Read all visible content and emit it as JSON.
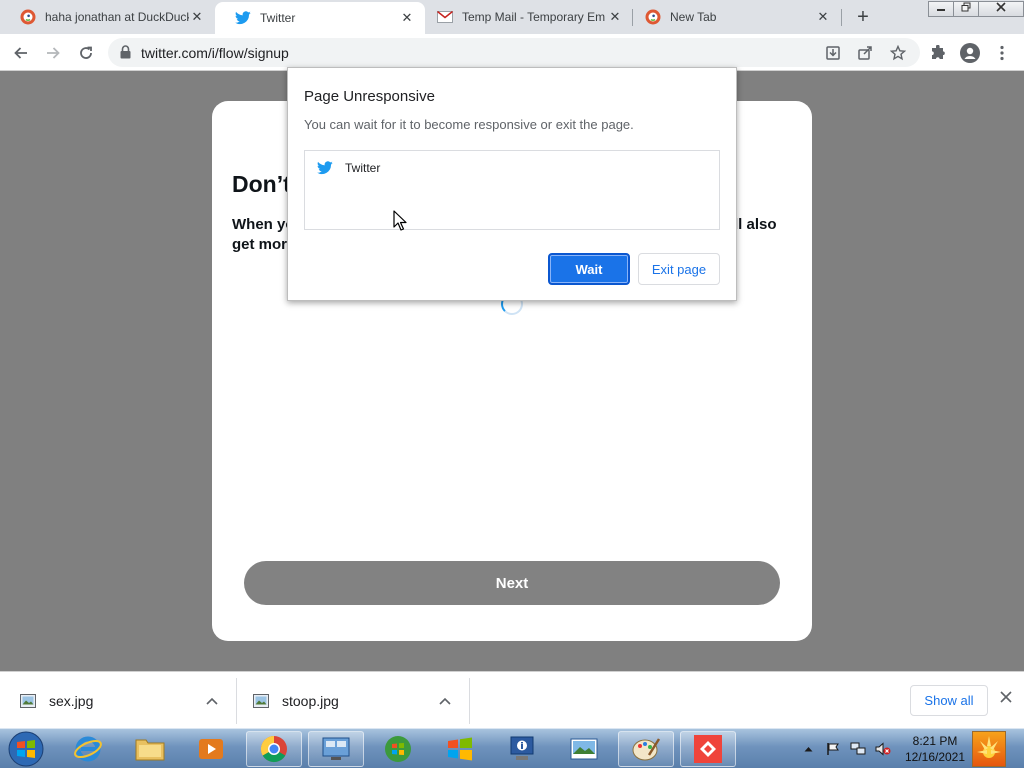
{
  "browser": {
    "tabs": [
      {
        "title": "haha jonathan at DuckDuck",
        "icon": "duckduckgo-icon",
        "active": false
      },
      {
        "title": "Twitter",
        "icon": "twitter-icon",
        "active": true
      },
      {
        "title": "Temp Mail - Temporary Em",
        "icon": "gmail-icon",
        "active": false
      },
      {
        "title": "New Tab",
        "icon": "duckduckgo-icon",
        "active": false
      }
    ],
    "new_tab_symbol": "+",
    "close_symbol": "✕",
    "url": "twitter.com/i/flow/signup"
  },
  "page": {
    "heading": "Don’t",
    "body_line1_left": "When yo",
    "body_line1_right": "ll also",
    "body_line2": "get more",
    "next_label": "Next"
  },
  "dialog": {
    "title": "Page Unresponsive",
    "message": "You can wait for it to become responsive or exit the page.",
    "page_entry": "Twitter",
    "wait_label": "Wait",
    "exit_label": "Exit page"
  },
  "downloads": {
    "items": [
      {
        "name": "sex.jpg"
      },
      {
        "name": "stoop.jpg"
      }
    ],
    "show_all_label": "Show all"
  },
  "taskbar": {
    "time": "8:21 PM",
    "date": "12/16/2021"
  },
  "colors": {
    "twitter_blue": "#1d9bf0",
    "chrome_blue": "#1a73e8",
    "overlay_gray": "#808080",
    "next_button_gray": "#828282"
  }
}
